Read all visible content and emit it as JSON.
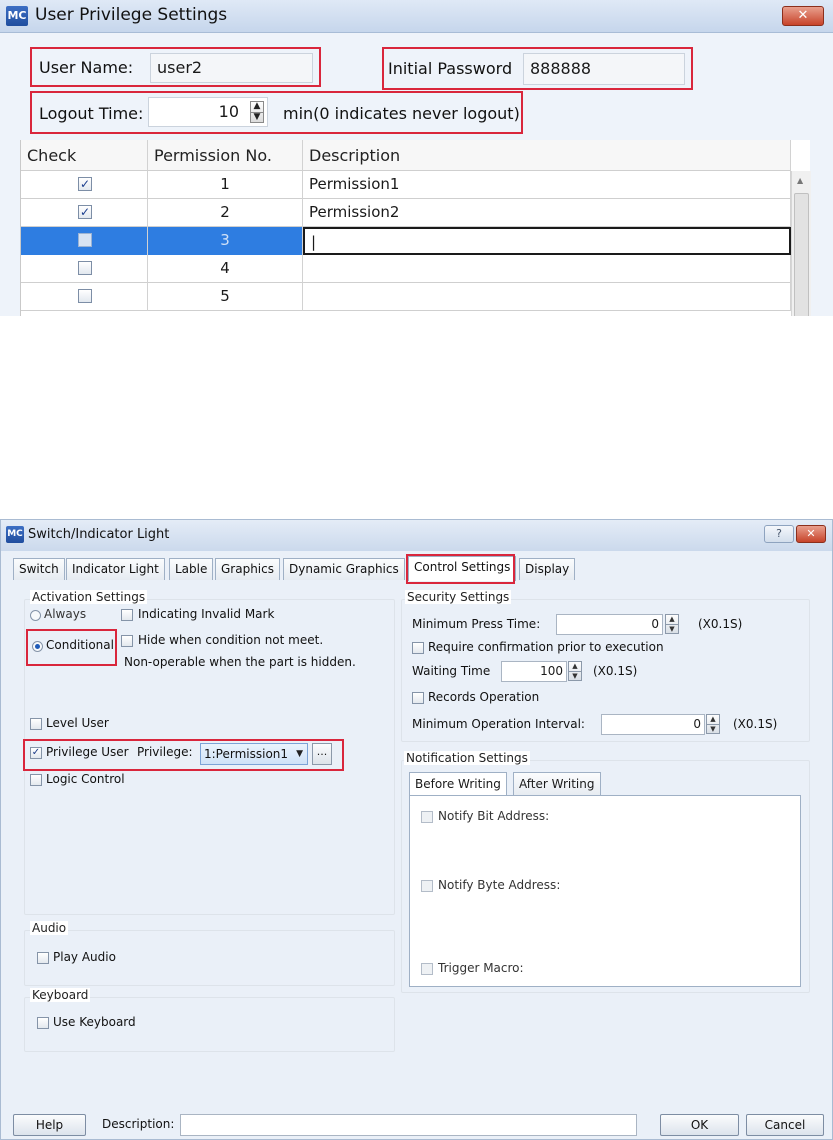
{
  "user_privilege": {
    "title": "User Privilege Settings",
    "logo": "MC",
    "close": "✕",
    "user_name_label": "User Name:",
    "user_name_value": "user2",
    "initial_password_label": "Initial Password",
    "initial_password_value": "888888",
    "logout_time_label": "Logout Time:",
    "logout_time_value": "10",
    "logout_time_note": "min(0 indicates never logout)",
    "columns": [
      "Check",
      "Permission No.",
      "Description"
    ],
    "rows": [
      {
        "checked": true,
        "no": "1",
        "description": "Permission1"
      },
      {
        "checked": true,
        "no": "2",
        "description": "Permission2"
      },
      {
        "checked": false,
        "no": "3",
        "description": "|",
        "selected": true
      },
      {
        "checked": false,
        "no": "4",
        "description": ""
      },
      {
        "checked": false,
        "no": "5",
        "description": ""
      }
    ]
  },
  "switch_dialog": {
    "title": "Switch/Indicator Light",
    "logo": "MC",
    "help_button": "?",
    "close": "✕",
    "tabs": [
      "Switch",
      "Indicator Light",
      "Lable",
      "Graphics",
      "Dynamic Graphics",
      "Control Settings",
      "Display"
    ],
    "active_tab": "Control Settings",
    "activation": {
      "title": "Activation Settings",
      "always": "Always",
      "indicating_invalid_mark": "Indicating Invalid Mark",
      "conditional": "Conditional",
      "hide_when": "Hide when condition not meet.",
      "non_operable": "Non-operable when the part is hidden.",
      "level_user": "Level User",
      "privilege_user": "Privilege User",
      "privilege_label": "Privilege:",
      "privilege_value": "1:Permission1",
      "browse": "...",
      "logic_control": "Logic Control"
    },
    "audio": {
      "title": "Audio",
      "play_audio": "Play Audio"
    },
    "keyboard": {
      "title": "Keyboard",
      "use_keyboard": "Use Keyboard"
    },
    "security": {
      "title": "Security Settings",
      "min_press_label": "Minimum Press Time:",
      "min_press_value": "0",
      "unit": "(X0.1S)",
      "require_confirmation": "Require confirmation prior to execution",
      "waiting_label": "Waiting Time",
      "waiting_value": "100",
      "records_operation": "Records Operation",
      "min_interval_label": "Minimum Operation Interval:",
      "min_interval_value": "0"
    },
    "notification": {
      "title": "Notification Settings",
      "tabs": [
        "Before Writing",
        "After Writing"
      ],
      "notify_bit": "Notify Bit Address:",
      "notify_byte": "Notify Byte Address:",
      "trigger_macro": "Trigger Macro:"
    },
    "footer": {
      "help": "Help",
      "description_label": "Description:",
      "ok": "OK",
      "cancel": "Cancel"
    }
  }
}
